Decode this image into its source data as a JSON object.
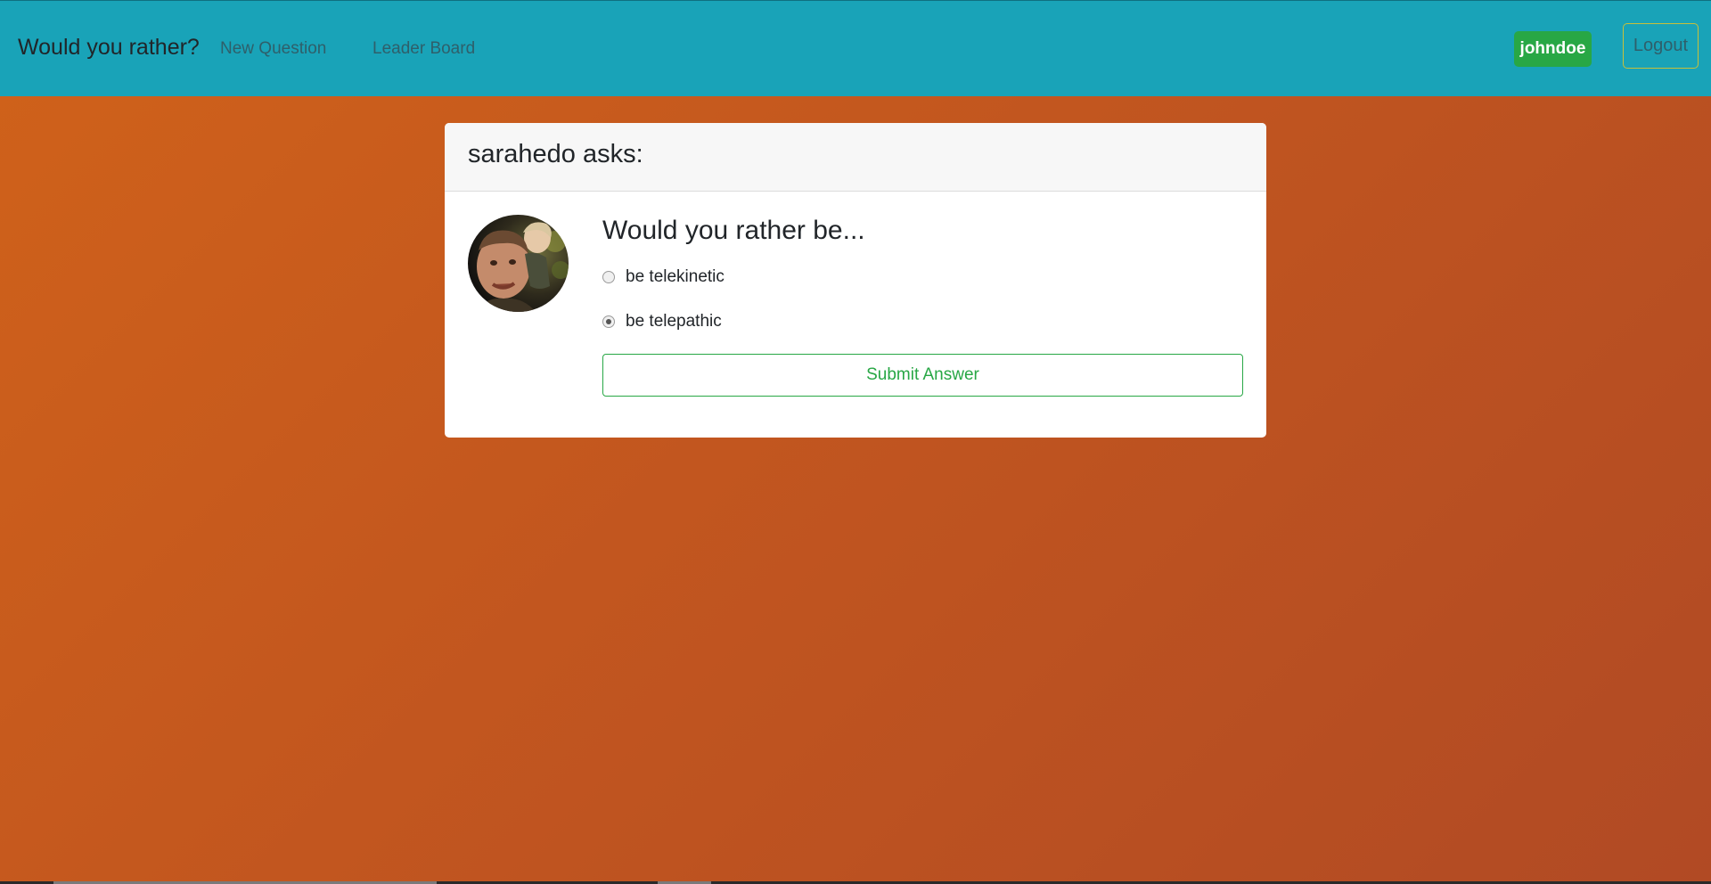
{
  "navbar": {
    "brand": "Would you rather?",
    "links": [
      {
        "label": "New Question"
      },
      {
        "label": "Leader Board"
      }
    ],
    "user": "johndoe",
    "logout_label": "Logout"
  },
  "question_card": {
    "header": "sarahedo asks:",
    "title": "Would you rather be...",
    "options": [
      {
        "label": "be telekinetic",
        "selected": false
      },
      {
        "label": "be telepathic",
        "selected": true
      }
    ],
    "submit_label": "Submit Answer",
    "avatar_icon": "user-avatar-photo"
  },
  "colors": {
    "navbar_bg": "#19a3b8",
    "page_bg_start": "#d0621a",
    "page_bg_end": "#b14a24",
    "success": "#28a745",
    "logout_border": "#c8c03a"
  }
}
